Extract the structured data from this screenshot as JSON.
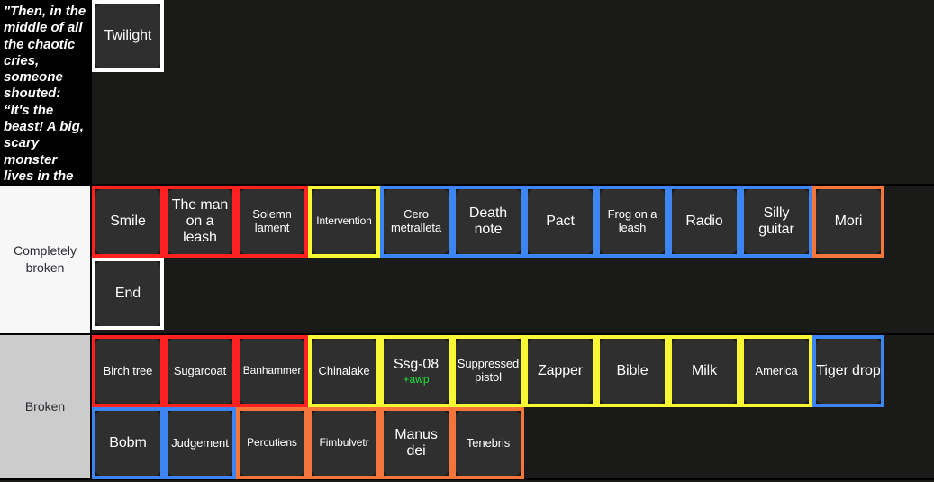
{
  "tiers": [
    {
      "id": "quote",
      "label": "\"Then, in the middle of all the chaotic cries, someone shouted: “It's the beast! A big, scary monster lives in the black, dusky forest!”",
      "label_style": "quote",
      "lines": [
        [
          {
            "name": "Twilight",
            "border": "white",
            "size": "md",
            "wrap": false
          }
        ]
      ]
    },
    {
      "id": "completely-broken",
      "label": "Completely broken",
      "label_style": "white",
      "lines": [
        [
          {
            "name": "Smile",
            "border": "red",
            "size": "md",
            "wrap": false
          },
          {
            "name": "The man on a leash",
            "border": "red",
            "size": "md",
            "wrap": true
          },
          {
            "name": "Solemn lament",
            "border": "red",
            "size": "sm",
            "wrap": true
          },
          {
            "name": "Intervention",
            "border": "yellow",
            "size": "xs",
            "wrap": false
          },
          {
            "name": "Cero metralleta",
            "border": "blue",
            "size": "sm",
            "wrap": true
          },
          {
            "name": "Death note",
            "border": "blue",
            "size": "md",
            "wrap": true
          },
          {
            "name": "Pact",
            "border": "blue",
            "size": "md",
            "wrap": false
          },
          {
            "name": "Frog on a leash",
            "border": "blue",
            "size": "sm",
            "wrap": true
          },
          {
            "name": "Radio",
            "border": "blue",
            "size": "md",
            "wrap": false
          },
          {
            "name": "Silly guitar",
            "border": "blue",
            "size": "md",
            "wrap": true
          },
          {
            "name": "Mori",
            "border": "orange",
            "size": "md",
            "wrap": false
          }
        ],
        [
          {
            "name": "End",
            "border": "white",
            "size": "md",
            "wrap": false
          }
        ]
      ]
    },
    {
      "id": "broken",
      "label": "Broken",
      "label_style": "gray",
      "lines": [
        [
          {
            "name": "Birch tree",
            "border": "red",
            "size": "sm",
            "wrap": false
          },
          {
            "name": "Sugarcoat",
            "border": "red",
            "size": "sm",
            "wrap": false
          },
          {
            "name": "Banhammer",
            "border": "red",
            "size": "xs",
            "wrap": false
          },
          {
            "name": "Chinalake",
            "border": "yellow",
            "size": "sm",
            "wrap": false
          },
          {
            "name": "Ssg-08",
            "sub": "+awp",
            "border": "yellow",
            "size": "md",
            "wrap": false
          },
          {
            "name": "Suppressed pistol",
            "border": "yellow",
            "size": "sm",
            "wrap": true
          },
          {
            "name": "Zapper",
            "border": "yellow",
            "size": "md",
            "wrap": false
          },
          {
            "name": "Bible",
            "border": "yellow",
            "size": "md",
            "wrap": false
          },
          {
            "name": "Milk",
            "border": "yellow",
            "size": "md",
            "wrap": false
          },
          {
            "name": "America",
            "border": "yellow",
            "size": "sm",
            "wrap": false
          },
          {
            "name": "Tiger drop",
            "border": "blue",
            "size": "md",
            "wrap": true
          }
        ],
        [
          {
            "name": "Bobm",
            "border": "blue",
            "size": "md",
            "wrap": false
          },
          {
            "name": "Judgement",
            "border": "blue",
            "size": "sm",
            "wrap": false
          },
          {
            "name": "Percutiens",
            "border": "orange",
            "size": "xs",
            "wrap": false
          },
          {
            "name": "Fimbulvetr",
            "border": "orange",
            "size": "xs",
            "wrap": false
          },
          {
            "name": "Manus dei",
            "border": "orange",
            "size": "md",
            "wrap": true
          },
          {
            "name": "Tenebris",
            "border": "orange",
            "size": "sm",
            "wrap": false
          }
        ]
      ]
    }
  ],
  "colors": {
    "red": "#ff2020",
    "yellow": "#f7f733",
    "blue": "#3d85f2",
    "orange": "#f4763a",
    "white": "#ffffff",
    "card_face": "#2f2f2f",
    "canvas": "#1a1a18",
    "sub_green": "#1fe33a"
  }
}
